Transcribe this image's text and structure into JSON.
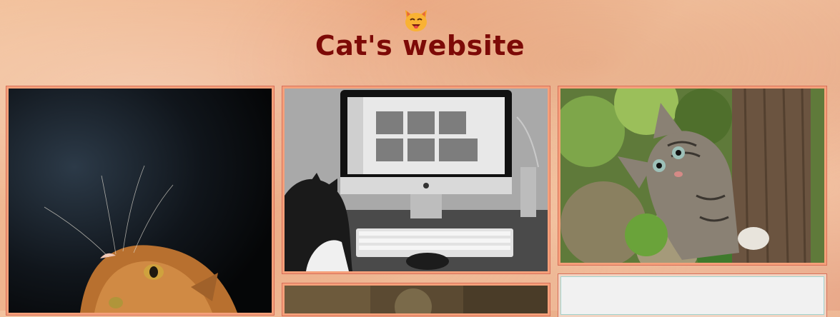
{
  "header": {
    "logo_icon": "smiling-cat-face-icon",
    "title": "Cat's website"
  },
  "gallery": {
    "cards": [
      {
        "image": "orange-cat-looking-up-photo"
      },
      {
        "image": "cat-watching-computer-screen-of-cats-photo"
      },
      {
        "image": "tabby-kitten-on-tree-photo"
      },
      {
        "image": "cat-photo-partially-visible"
      },
      {
        "image": "placeholder-image-blank"
      }
    ]
  },
  "colors": {
    "title": "#7d0a07",
    "background": "#eeb08a",
    "card_border": "#f5a07a"
  }
}
